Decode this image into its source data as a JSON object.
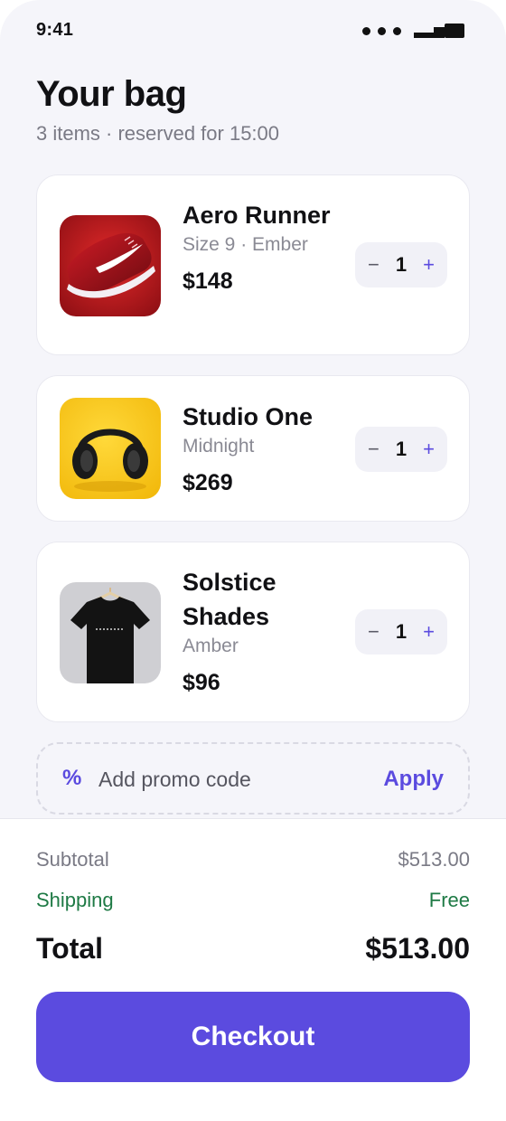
{
  "status_bar": {
    "time": "9:41"
  },
  "header": {
    "title": "Your bag",
    "subtitle": "3 items · reserved for 15:00"
  },
  "items": [
    {
      "name": "Aero Runner",
      "variant": "Size 9 · Ember",
      "price": "$148",
      "quantity": "1",
      "image": "red-sneaker"
    },
    {
      "name": "Studio One",
      "variant": "Midnight",
      "price": "$269",
      "quantity": "1",
      "image": "black-headphones-on-yellow"
    },
    {
      "name": "Solstice Shades",
      "variant": "Amber",
      "price": "$96",
      "quantity": "1",
      "image": "black-tshirt-on-hanger"
    }
  ],
  "stepper": {
    "minus": "−",
    "plus": "+"
  },
  "promo": {
    "icon": "%",
    "label": "Add promo code",
    "action": "Apply"
  },
  "summary": {
    "subtotal_label": "Subtotal",
    "subtotal_value": "$513.00",
    "shipping_label": "Shipping",
    "shipping_value": "Free",
    "total_label": "Total",
    "total_value": "$513.00"
  },
  "checkout_label": "Checkout",
  "colors": {
    "accent": "#5b4bdf",
    "shipping": "#1e7a45",
    "background": "#f5f5fa"
  }
}
